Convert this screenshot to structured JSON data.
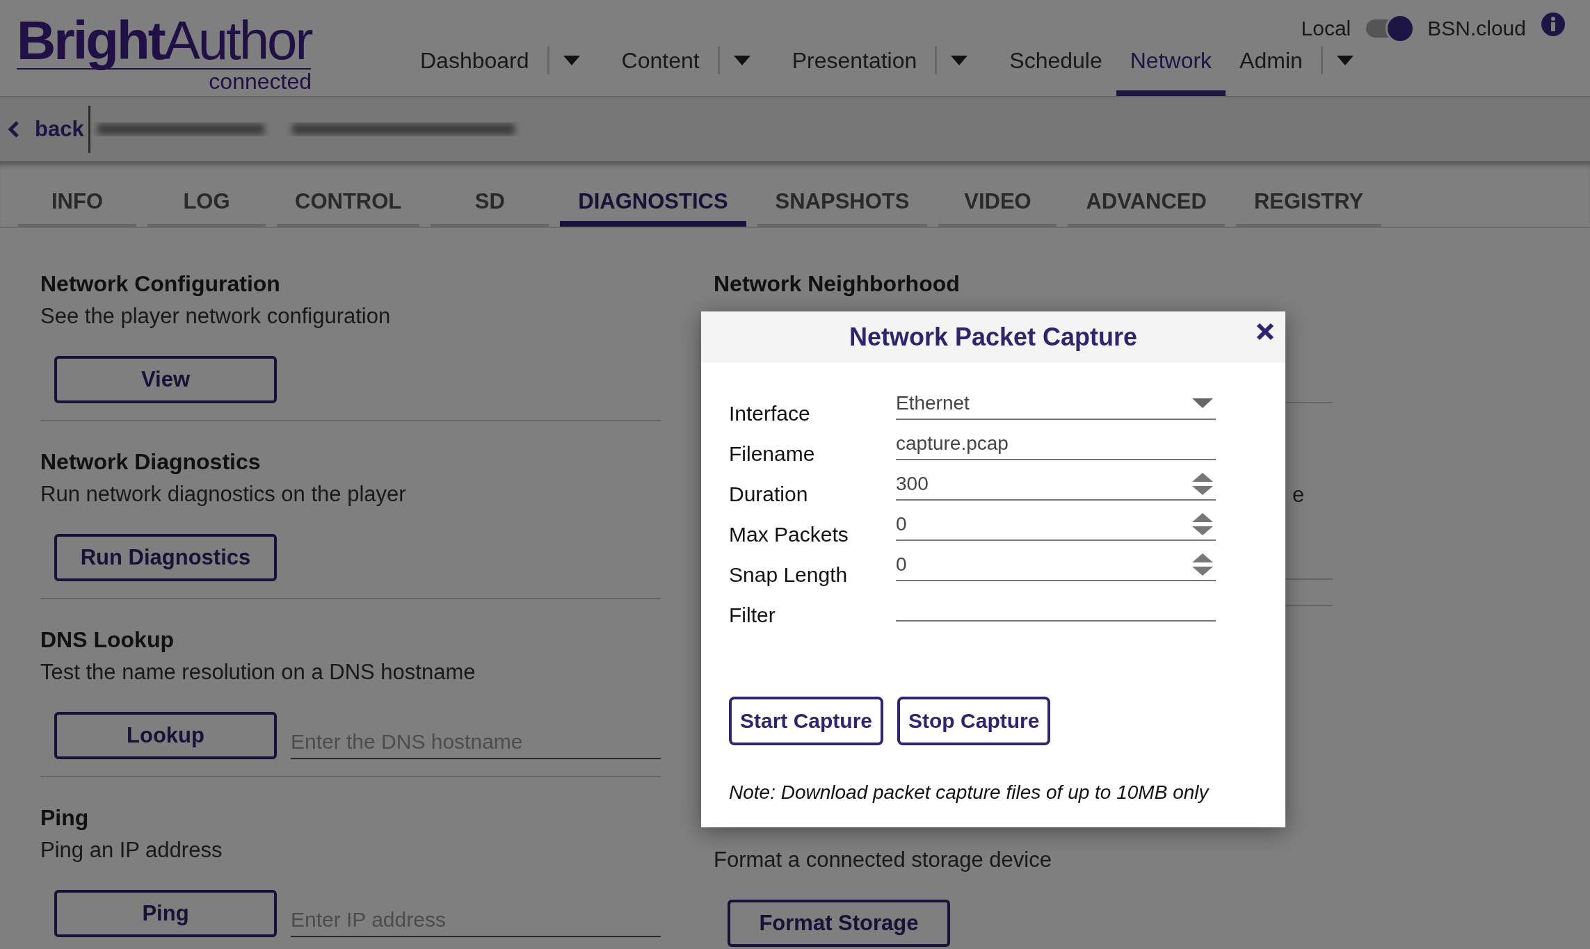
{
  "header": {
    "logo": {
      "name": "**Bright**Author",
      "tagline": "connected"
    },
    "nav": [
      {
        "label": "Dashboard",
        "selected": false,
        "dropdown": true
      },
      {
        "label": "Content",
        "selected": false,
        "dropdown": true
      },
      {
        "label": "Presentation",
        "selected": false,
        "dropdown": true
      },
      {
        "label": "Schedule",
        "selected": false,
        "dropdown": false
      },
      {
        "label": "Network",
        "selected": true,
        "dropdown": false
      },
      {
        "label": "Admin",
        "selected": false,
        "dropdown": true
      }
    ],
    "mode_toggle": {
      "left_label": "Local",
      "right_label": "BSN.cloud",
      "on": true
    }
  },
  "breadcrumb": {
    "back": "back"
  },
  "tabs": [
    {
      "label": "INFO",
      "selected": false
    },
    {
      "label": "LOG",
      "selected": false
    },
    {
      "label": "CONTROL",
      "selected": false
    },
    {
      "label": "SD",
      "selected": false
    },
    {
      "label": "DIAGNOSTICS",
      "selected": true
    },
    {
      "label": "SNAPSHOTS",
      "selected": false
    },
    {
      "label": "VIDEO",
      "selected": false
    },
    {
      "label": "ADVANCED",
      "selected": false
    },
    {
      "label": "REGISTRY",
      "selected": false
    }
  ],
  "left_sections": [
    {
      "title": "Network Configuration",
      "description": "See the player network configuration",
      "button": "View"
    },
    {
      "title": "Network Diagnostics",
      "description": "Run network diagnostics on the player",
      "button": "Run Diagnostics"
    },
    {
      "title": "DNS Lookup",
      "description": "Test the name resolution on a DNS hostname",
      "button": "Lookup",
      "placeholder": "Enter the DNS hostname"
    },
    {
      "title": "Ping",
      "description": "Ping an IP address",
      "button": "Ping",
      "placeholder": "Enter IP address"
    }
  ],
  "right_sections": [
    {
      "title": "Network Neighborhood"
    },
    {
      "description_fragment": "e"
    },
    {
      "description": "Format a connected storage device",
      "button": "Format Storage"
    }
  ],
  "dialog": {
    "title": "Network Packet Capture",
    "fields": [
      {
        "label": "Interface",
        "kind": "select",
        "value": "Ethernet"
      },
      {
        "label": "Filename",
        "kind": "text",
        "value": "capture.pcap"
      },
      {
        "label": "Duration",
        "kind": "number",
        "value": "300"
      },
      {
        "label": "Max Packets",
        "kind": "number",
        "value": "0"
      },
      {
        "label": "Snap Length",
        "kind": "number",
        "value": "0"
      },
      {
        "label": "Filter",
        "kind": "text"
      }
    ],
    "buttons": [
      "Start Capture",
      "Stop Capture"
    ],
    "note": "Note: Download packet capture files of up to 10MB only"
  }
}
